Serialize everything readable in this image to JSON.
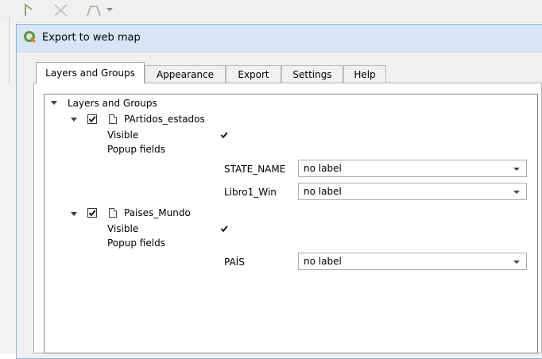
{
  "window": {
    "title": "Export to web map"
  },
  "tabs": [
    {
      "label": "Layers and Groups",
      "active": true
    },
    {
      "label": "Appearance",
      "active": false
    },
    {
      "label": "Export",
      "active": false
    },
    {
      "label": "Settings",
      "active": false
    },
    {
      "label": "Help",
      "active": false
    }
  ],
  "tree": {
    "root_label": "Layers and Groups",
    "layers": [
      {
        "name": "PArtidos_estados",
        "checked": true,
        "visible_label": "Visible",
        "visible_checked": true,
        "popup_label": "Popup fields",
        "fields": [
          {
            "name": "STATE_NAME",
            "value": "no label"
          },
          {
            "name": "Libro1_Win",
            "value": "no label"
          }
        ]
      },
      {
        "name": "Paises_Mundo",
        "checked": true,
        "visible_label": "Visible",
        "visible_checked": true,
        "popup_label": "Popup fields",
        "fields": [
          {
            "name": "PAÍS",
            "value": "no label"
          }
        ]
      }
    ]
  },
  "colors": {
    "titlebar": "#d6e6f6",
    "app_icon": "#589632"
  },
  "icons": {
    "app": "qgis-icon",
    "expand": "chevron-down-icon",
    "checkbox": "checkmark-icon",
    "layer": "vector-layer-icon",
    "dropdown": "dropdown-arrow-icon"
  }
}
